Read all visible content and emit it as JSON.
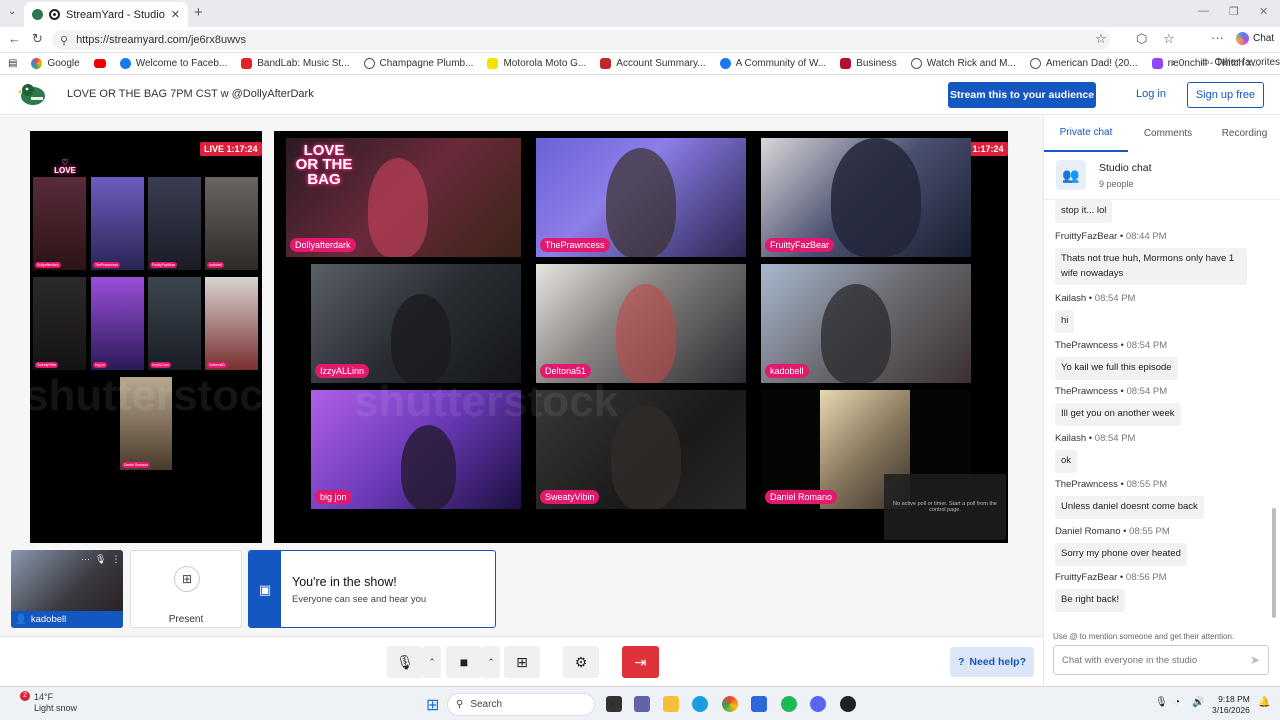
{
  "browser": {
    "tab_title": "StreamYard - Studio",
    "url": "https://streamyard.com/je6rx8uwvs",
    "chat_label": "Chat",
    "bookmarks": [
      "Google",
      "",
      "Welcome to Faceb...",
      "BandLab: Music St...",
      "Champagne Plumb...",
      "Motorola Moto G...",
      "Account Summary...",
      "A Community of W...",
      "Business",
      "Watch Rick and M...",
      "American Dad! (20...",
      "ne0nchill - Twitch x..."
    ],
    "other_favorites": "Other favorites"
  },
  "header": {
    "show_title": "LOVE OR THE BAG 7PM CST w @DollyAfterDark",
    "stream_button": "Stream this to your audience",
    "login": "Log in",
    "signup": "Sign up free"
  },
  "stage": {
    "live_badge": "LIVE 1:17:24",
    "logo_text": "LOVE OR THE BAG",
    "participants": [
      "Dollyafterdark",
      "ThePrawncess",
      "FruittyFazBear",
      "IzzyALLinn",
      "Deltona51",
      "kadobell",
      "big jon",
      "SweatyVibin",
      "Daniel Romano"
    ],
    "poll_text": "No active poll or timer. Start a poll from the control page."
  },
  "tray": {
    "my_name": "kadobell",
    "present_label": "Present",
    "in_show_title": "You're in the show!",
    "in_show_sub": "Everyone can see and hear you"
  },
  "controls": {
    "help": "Need help?"
  },
  "chat": {
    "tabs": [
      "Private chat",
      "Comments",
      "Recording"
    ],
    "studio_title": "Studio chat",
    "studio_count": "9 people",
    "first_partial": "stop it... lol",
    "messages": [
      {
        "author": "FruittyFazBear",
        "time": "08:44 PM",
        "text": "Thats not true huh, Mormons only have 1 wife nowadays"
      },
      {
        "author": "Kailash",
        "time": "08:54 PM",
        "text": "hi"
      },
      {
        "author": "ThePrawncess",
        "time": "08:54 PM",
        "text": "Yo kail we full this episode"
      },
      {
        "author": "ThePrawncess",
        "time": "08:54 PM",
        "text": "Ill get you on another week"
      },
      {
        "author": "Kailash",
        "time": "08:54 PM",
        "text": "ok"
      },
      {
        "author": "ThePrawncess",
        "time": "08:55 PM",
        "text": "Unless daniel doesnt come back"
      },
      {
        "author": "Daniel Romano",
        "time": "08:55 PM",
        "text": "Sorry my phone over heated"
      },
      {
        "author": "FruittyFazBear",
        "time": "08:56 PM",
        "text": "Be right back!"
      }
    ],
    "mention_hint": "Use @ to mention someone and get their attention.",
    "input_placeholder": "Chat with everyone in the studio"
  },
  "taskbar": {
    "temp": "14°F",
    "weather": "Light snow",
    "search": "Search",
    "time": "9:18 PM",
    "date": "3/16/2026",
    "weather_badge": "2"
  }
}
